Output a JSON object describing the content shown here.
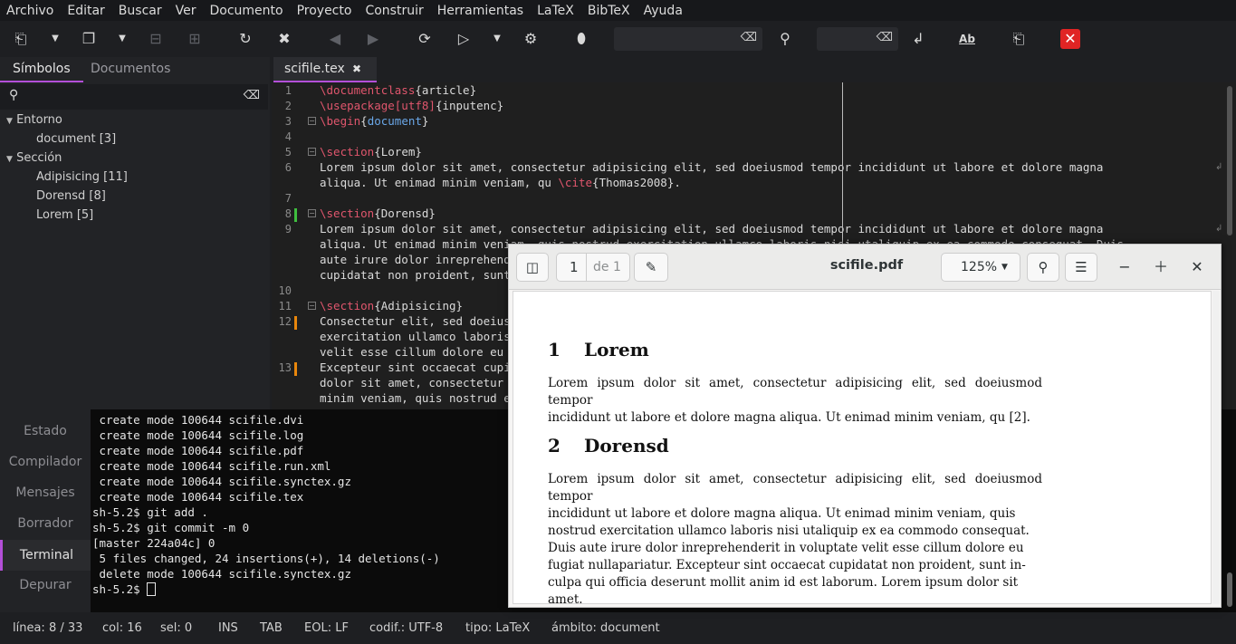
{
  "menu": [
    "Archivo",
    "Editar",
    "Buscar",
    "Ver",
    "Documento",
    "Proyecto",
    "Construir",
    "Herramientas",
    "LaTeX",
    "BibTeX",
    "Ayuda"
  ],
  "left_panel": {
    "tabs": [
      "Símbolos",
      "Documentos"
    ],
    "tree": [
      {
        "label": "Entorno",
        "children": [
          "document [3]"
        ]
      },
      {
        "label": "Sección",
        "children": [
          "Adipisicing [11]",
          "Dorensd [8]",
          "Lorem [5]"
        ]
      }
    ]
  },
  "editor": {
    "tab_label": "scifile.tex",
    "line_numbers": [
      "1",
      "2",
      "3",
      "4",
      "5",
      "6",
      "7",
      "8",
      "9",
      "10",
      "11",
      "12",
      "13"
    ],
    "lines": [
      "\\documentclass{article}",
      "\\usepackage[utf8]{inputenc}",
      "\\begin{document}",
      "",
      "\\section{Lorem}",
      "Lorem ipsum dolor sit amet, consectetur adipisicing elit, sed doeiusmod tempor incididunt ut labore et dolore magna",
      "aliqua. Ut enimad minim veniam, qu \\cite{Thomas2008}.",
      "",
      "\\section{Dorensd}",
      "Lorem ipsum dolor sit amet, consectetur adipisicing elit, sed doeiusmod tempor incididunt ut labore et dolore magna",
      "aliqua. Ut enimad minim veniam, quis nostrud exercitation ullamco laboris nisi utaliquip ex ea commodo consequat. Duis",
      "aute irure dolor inreprehenderit in voluptate velit esse cillum dolore eu fugiat nullapariatur.",
      "cupidatat non proident, sunt inculpa qui officia deserunt mollit anim id est laborum.",
      "",
      "\\section{Adipisicing}",
      "Consectetur elit, sed doeiusmod tempor incididunt ut labore et dolore magna aliqua. Ut enim ad minim veniam, quis nostrud",
      "exercitation ullamco laboris nisi ut aliquip ex ea commodo consequat.",
      "velit esse cillum dolore eu fugiat nulla pariatur.",
      "Excepteur sint occaecat cupidatat non proident, sunt in culpa qui officia deserunt mollit anim id est laborum. Lorem ipsum",
      "dolor sit amet, consectetur adipisicing elit, sed do eiusmod tempor incididunt ut labore et dolore magna aliqua. Ut enim ad",
      "minim veniam, quis nostrud exercitation ullamco."
    ]
  },
  "bottom_tabs": [
    "Estado",
    "Compilador",
    "Mensajes",
    "Borrador",
    "Terminal",
    "Depurar"
  ],
  "terminal": [
    " create mode 100644 scifile.dvi",
    " create mode 100644 scifile.log",
    " create mode 100644 scifile.pdf",
    " create mode 100644 scifile.run.xml",
    " create mode 100644 scifile.synctex.gz",
    " create mode 100644 scifile.tex",
    "sh-5.2$ git add .",
    "sh-5.2$ git commit -m 0",
    "[master 224a04c] 0",
    " 5 files changed, 24 insertions(+), 14 deletions(-)",
    " delete mode 100644 scifile.synctex.gz",
    "sh-5.2$ "
  ],
  "status": {
    "line": "línea: 8 / 33",
    "col": "col: 16",
    "sel": "sel: 0",
    "mode": "INS",
    "tab": "TAB",
    "eol": "EOL: LF",
    "encoding": "codif.: UTF-8",
    "type": "tipo: LaTeX",
    "scope": "ámbito: document"
  },
  "pdf": {
    "title": "scifile.pdf",
    "page": "1",
    "page_of": "de 1",
    "zoom": "125%",
    "sections": [
      {
        "num": "1",
        "title": "Lorem",
        "lines": [
          "Lorem ipsum dolor sit amet, consectetur adipisicing elit, sed doeiusmod tempor",
          "incididunt ut labore et dolore magna aliqua. Ut enimad minim veniam, qu [2]."
        ]
      },
      {
        "num": "2",
        "title": "Dorensd",
        "lines": [
          "Lorem ipsum dolor sit amet, consectetur adipisicing elit, sed doeiusmod tempor",
          "incididunt ut labore et dolore magna aliqua.  Ut enimad minim veniam, quis",
          "nostrud exercitation ullamco laboris nisi utaliquip ex ea commodo consequat.",
          "Duis aute irure dolor inreprehenderit in voluptate velit esse cillum dolore eu",
          "fugiat nullapariatur.  Excepteur sint occaecat cupidatat non proident, sunt in-",
          "culpa qui officia deserunt mollit anim id est laborum.  Lorem ipsum dolor sit",
          "amet."
        ]
      }
    ]
  },
  "colors": {
    "accent": "#b34fd8",
    "latex_command": "#e0566d",
    "latex_argument": "#6aa7e8",
    "change_saved": "#3fbf3f",
    "change_unsaved": "#e8860c",
    "close_red": "#e02424"
  }
}
